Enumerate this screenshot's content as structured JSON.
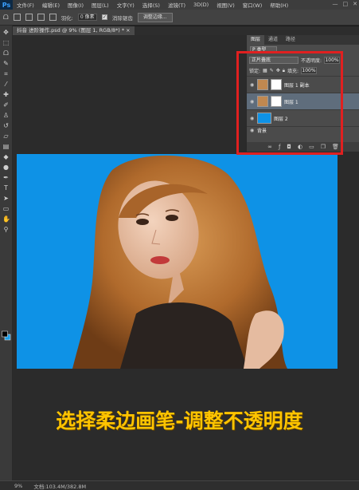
{
  "app": {
    "logo": "Ps"
  },
  "menu": [
    "文件(F)",
    "编辑(E)",
    "图像(I)",
    "图层(L)",
    "文字(Y)",
    "选择(S)",
    "滤镜(T)",
    "3D(D)",
    "视图(V)",
    "窗口(W)",
    "帮助(H)"
  ],
  "window_controls": {
    "min": "—",
    "max": "□",
    "close": "✕"
  },
  "options": {
    "feather_label": "羽化:",
    "feather_value": "0 像素",
    "antialias_label": "消除锯齿",
    "refine_button": "调整边缘..."
  },
  "document_tab": "抖音 进阶操作.psd @ 9% (图层 1, RGB/8*) * ×",
  "layers_panel": {
    "tabs": [
      "图层",
      "通道",
      "路径"
    ],
    "filter_label": "P 类型",
    "blend_mode": "正片叠底",
    "opacity_label": "不透明度:",
    "opacity_value": "100%",
    "lock_label": "锁定:",
    "fill_label": "填充:",
    "fill_value": "100%",
    "layers": [
      {
        "name": "图层 1 副本",
        "selected": false
      },
      {
        "name": "图层 1",
        "selected": true
      },
      {
        "name": "图层 2",
        "selected": false
      },
      {
        "name": "背景",
        "selected": false
      }
    ],
    "footer_icons": [
      "link-icon",
      "fx-icon",
      "mask-icon",
      "adjustment-icon",
      "folder-icon",
      "new-layer-icon",
      "trash-icon"
    ]
  },
  "caption": "选择柔边画笔-调整不透明度",
  "status": {
    "zoom": "9%",
    "doc": "文档:103.4M/382.8M"
  },
  "colors": {
    "accent_red": "#e02020",
    "canvas_blue": "#0e92e6",
    "caption": "#ffc400"
  }
}
